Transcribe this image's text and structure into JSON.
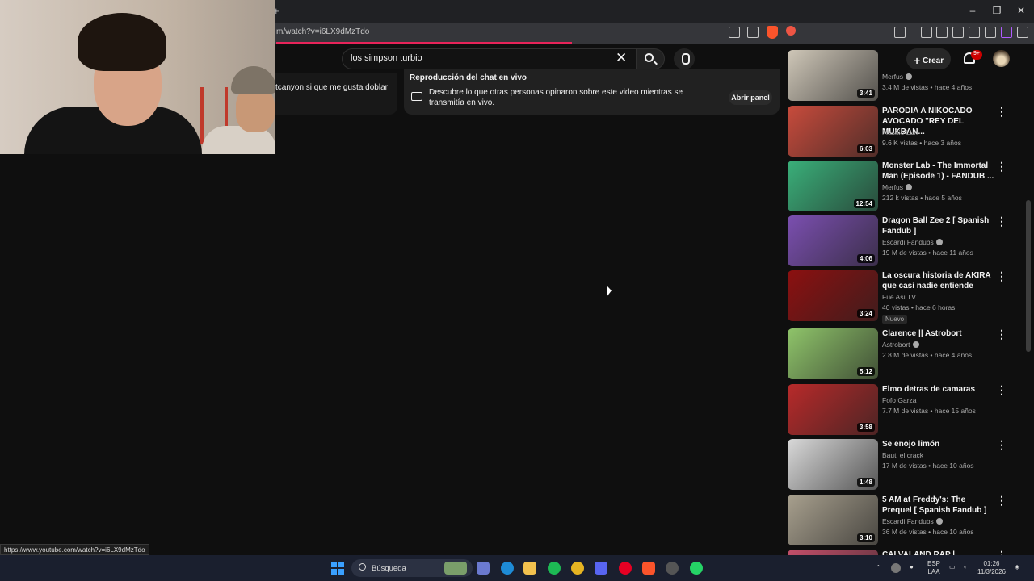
{
  "browser": {
    "tab_plus": "+",
    "url": "m/watch?v=i6LX9dMzTdo",
    "status_url": "https://www.youtube.com/watch?v=i6LX9dMzTdo",
    "window_controls": [
      "–",
      "❐",
      "✕"
    ]
  },
  "header": {
    "search_query": "los simpson turbio",
    "create_label": "Crear",
    "notifications_badge": "9+"
  },
  "comment_snippet": "tcanyon  si que me gusta doblar",
  "live_chat": {
    "title": "Reproducción del chat en vivo",
    "description": "Descubre lo que otras personas opinaron sobre este video mientras se transmitía en vivo.",
    "button": "Abrir panel"
  },
  "sidebar": {
    "videos": [
      {
        "title": "",
        "channel": "Merfus",
        "verified": true,
        "meta": "3.4 M de vistas • hace 4 años",
        "duration": "3:41",
        "thumb_color": "#cfc7b8"
      },
      {
        "title": "PARODIA A NIKOCADO AVOCADO \"REY DEL MUKBAN...",
        "channel": "Mashio Lun",
        "verified": false,
        "meta": "9.6 K vistas • hace 3 años",
        "duration": "6:03",
        "thumb_color": "#c84b3c"
      },
      {
        "title": "Monster Lab - The Immortal Man (Episode 1)  - FANDUB ...",
        "channel": "Merfus",
        "verified": true,
        "meta": "212 k vistas • hace 5 años",
        "duration": "12:54",
        "thumb_color": "#3ab07a"
      },
      {
        "title": "Dragon Ball Zee 2 [ Spanish Fandub ]",
        "channel": "Escardi Fandubs",
        "verified": true,
        "meta": "19 M de vistas • hace 11 años",
        "duration": "4:06",
        "thumb_color": "#7b4fb0"
      },
      {
        "title": "La oscura historia de AKIRA que casi nadie entiende",
        "channel": "Fue Así TV",
        "verified": false,
        "meta": "40 vistas • hace 6 horas",
        "badge": "Nuevo",
        "duration": "3:24",
        "thumb_color": "#8c1010"
      },
      {
        "title": "Clarence || Astrobort",
        "channel": "Astrobort",
        "verified": true,
        "meta": "2.8 M de vistas • hace 4 años",
        "duration": "5:12",
        "thumb_color": "#8fc46a"
      },
      {
        "title": "Elmo detras de camaras",
        "channel": "Fofo Garza",
        "verified": false,
        "meta": "7.7 M de vistas • hace 15 años",
        "duration": "3:58",
        "thumb_color": "#b82a2a"
      },
      {
        "title": "Se enojo limón",
        "channel": "Bauti el crack",
        "verified": false,
        "meta": "17 M de vistas • hace 10 años",
        "duration": "1:48",
        "thumb_color": "#d9d9d9"
      },
      {
        "title": "5 AM at Freddy's: The Prequel [ Spanish Fandub ]",
        "channel": "Escardi Fandubs",
        "verified": true,
        "meta": "36 M de vistas • hace 10 años",
        "duration": "3:10",
        "thumb_color": "#a8a08e"
      },
      {
        "title": "CALVALAND RAP | ZARCORT Y",
        "channel": "",
        "verified": false,
        "meta": "",
        "duration": "",
        "thumb_color": "#c44f6a"
      }
    ]
  },
  "taskbar": {
    "search_label": "Búsqueda",
    "lang_top": "ESP",
    "lang_bottom": "LAA",
    "time": "01:26",
    "date": "11/3/2026"
  }
}
